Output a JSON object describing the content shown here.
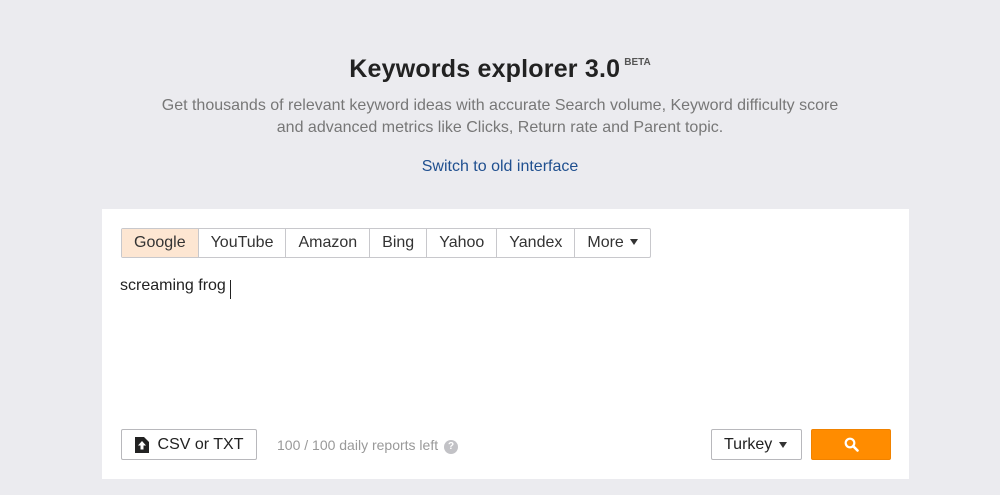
{
  "header": {
    "title": "Keywords explorer 3.0",
    "badge": "BETA",
    "subtitle": "Get thousands of relevant keyword ideas with accurate Search volume, Keyword difficulty score and advanced metrics like Clicks, Return rate and Parent topic.",
    "switch_link": "Switch to old interface"
  },
  "engines": {
    "tabs": [
      {
        "label": "Google",
        "active": true
      },
      {
        "label": "YouTube"
      },
      {
        "label": "Amazon"
      },
      {
        "label": "Bing"
      },
      {
        "label": "Yahoo"
      },
      {
        "label": "Yandex"
      },
      {
        "label": "More"
      }
    ]
  },
  "keywords_input": {
    "value": "screaming frog"
  },
  "footer": {
    "upload_label": "CSV or TXT",
    "reports_left": "100 / 100 daily reports left",
    "help_glyph": "?",
    "country": "Turkey"
  },
  "colors": {
    "accent": "#ff8c00",
    "active_tab_bg": "#fde6d2",
    "link": "#1f4f8f",
    "background": "#ebebef"
  },
  "icons": {
    "upload": "upload-icon",
    "search": "search-icon",
    "help": "help-icon",
    "caret": "caret-down-icon"
  }
}
